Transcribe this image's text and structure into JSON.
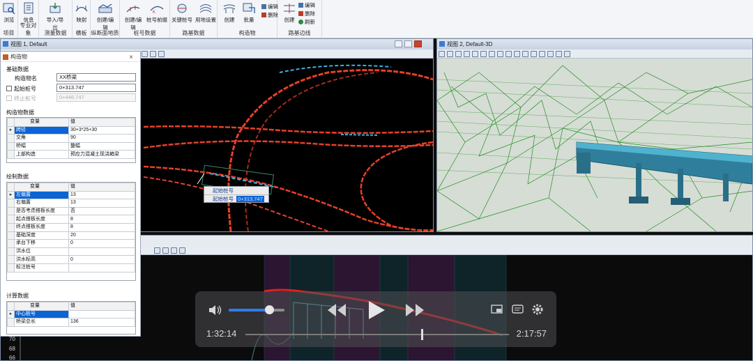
{
  "ribbon": {
    "groups": [
      {
        "label": "项目",
        "buttons": [
          "浏览"
        ]
      },
      {
        "label": "专业对象",
        "buttons": [
          "信息"
        ]
      },
      {
        "label": "测量数据",
        "buttons": [
          "导入/导出"
        ]
      },
      {
        "label": "横板",
        "buttons": [
          "映射"
        ]
      },
      {
        "label": "纵断面地质",
        "buttons": [
          "创建/编辑"
        ]
      },
      {
        "label": "桩号数据",
        "buttons": [
          "创建/编辑",
          "桩号前缀"
        ]
      },
      {
        "label": "路基数据",
        "buttons": [
          "关键桩号",
          "用地设置"
        ]
      },
      {
        "label": "构造物",
        "buttons": [
          "创建",
          "批量"
        ]
      },
      {
        "label": "路基边线",
        "buttons": [
          "创建"
        ]
      }
    ],
    "structure_small": [
      "编辑",
      "删除"
    ],
    "edge_small": [
      "编辑",
      "删除",
      "刷新"
    ]
  },
  "view1": {
    "title": "视图 1, Default"
  },
  "view2": {
    "title": "视图 2, Default-3D"
  },
  "tooltip": {
    "title": "起始桩号",
    "label": "起始桩号",
    "value": "0+313.747"
  },
  "dialog": {
    "title": "构造物",
    "basic_section": "基础数据",
    "name_label": "构造物名",
    "name_value": "XX桥梁",
    "start_label": "起始桩号",
    "start_value": "0+313.747",
    "end_label": "终止桩号",
    "end_value": "0+448.747",
    "struct_section": "构造物数据",
    "col_var": "变量",
    "col_val": "值",
    "struct_rows": [
      {
        "name": "跨径",
        "value": "30+3*25+30"
      },
      {
        "name": "交角",
        "value": "90"
      },
      {
        "name": "桥幅",
        "value": "整幅"
      },
      {
        "name": "上部构造",
        "value": "预应力混凝土现浇箱梁"
      }
    ],
    "draw_section": "绘制数据",
    "draw_rows": [
      {
        "name": "左偏置",
        "value": "13"
      },
      {
        "name": "右偏置",
        "value": "13"
      },
      {
        "name": "是否考虑搭板长度",
        "value": "否"
      },
      {
        "name": "起点搭板长度",
        "value": "8"
      },
      {
        "name": "终点搭板长度",
        "value": "8"
      },
      {
        "name": "基础深度",
        "value": "20"
      },
      {
        "name": "承台下移",
        "value": "0"
      },
      {
        "name": "洪水位",
        "value": ""
      },
      {
        "name": "洪水标高",
        "value": "0"
      },
      {
        "name": "标注桩号",
        "value": ""
      }
    ],
    "calc_section": "计算数据",
    "calc_rows": [
      {
        "name": "中心桩号",
        "value": ""
      },
      {
        "name": "桥梁总长",
        "value": "136"
      }
    ]
  },
  "profile": {
    "axis_labels": [
      "70",
      "68",
      "66"
    ]
  },
  "player": {
    "current_time": "1:32:14",
    "total_time": "2:17:57",
    "volume": 0.73,
    "progress": 0.669
  }
}
